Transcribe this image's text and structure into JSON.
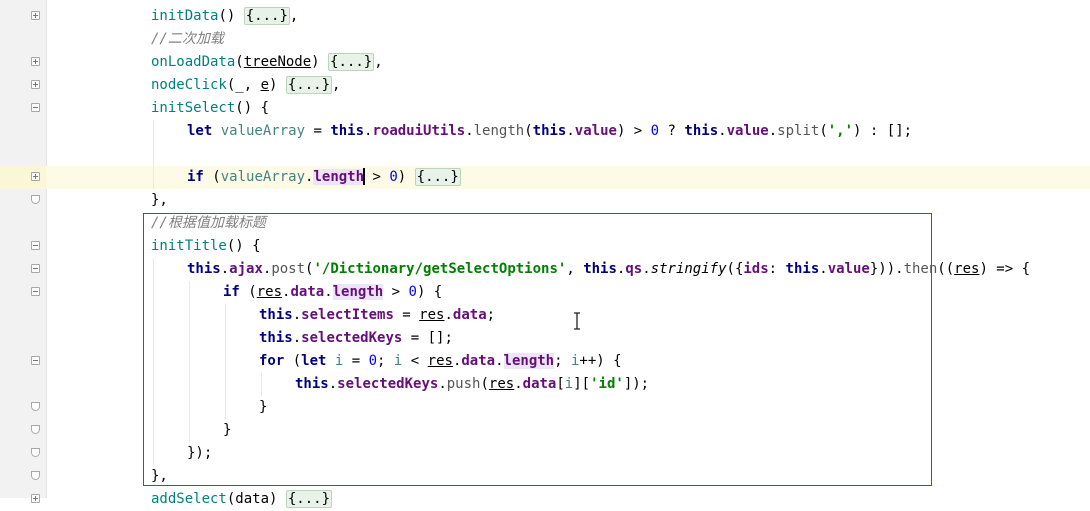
{
  "editor": {
    "lines": [
      {
        "id": "l1",
        "fold": "plus",
        "indent": 0,
        "tokens": [
          {
            "t": "initData",
            "c": "fn"
          },
          {
            "t": "() ",
            "c": ""
          },
          {
            "t": "{...}",
            "c": "folded"
          },
          {
            "t": ",",
            "c": ""
          }
        ]
      },
      {
        "id": "l2",
        "fold": "",
        "indent": 0,
        "tokens": [
          {
            "t": "//二次加载",
            "c": "cm"
          }
        ]
      },
      {
        "id": "l3",
        "fold": "plus",
        "indent": 0,
        "tokens": [
          {
            "t": "onLoadData",
            "c": "fn"
          },
          {
            "t": "(",
            "c": ""
          },
          {
            "t": "treeNode",
            "c": "ul"
          },
          {
            "t": ") ",
            "c": ""
          },
          {
            "t": "{...}",
            "c": "folded"
          },
          {
            "t": ",",
            "c": ""
          }
        ]
      },
      {
        "id": "l4",
        "fold": "plus",
        "indent": 0,
        "tokens": [
          {
            "t": "nodeClick",
            "c": "fn"
          },
          {
            "t": "(_, ",
            "c": ""
          },
          {
            "t": "e",
            "c": "ul"
          },
          {
            "t": ") ",
            "c": ""
          },
          {
            "t": "{...}",
            "c": "folded"
          },
          {
            "t": ",",
            "c": ""
          }
        ]
      },
      {
        "id": "l5",
        "fold": "minus",
        "indent": 0,
        "tokens": [
          {
            "t": "initSelect",
            "c": "fn"
          },
          {
            "t": "() {",
            "c": ""
          }
        ]
      },
      {
        "id": "l6",
        "fold": "",
        "indent": 1,
        "tokens": [
          {
            "t": "let ",
            "c": "kw"
          },
          {
            "t": "valueArray",
            "c": "var"
          },
          {
            "t": " = ",
            "c": ""
          },
          {
            "t": "this",
            "c": "kw"
          },
          {
            "t": ".",
            "c": ""
          },
          {
            "t": "roaduiUtils",
            "c": "prop"
          },
          {
            "t": ".",
            "c": ""
          },
          {
            "t": "length",
            "c": "call"
          },
          {
            "t": "(",
            "c": ""
          },
          {
            "t": "this",
            "c": "kw"
          },
          {
            "t": ".",
            "c": ""
          },
          {
            "t": "value",
            "c": "prop"
          },
          {
            "t": ") > ",
            "c": ""
          },
          {
            "t": "0",
            "c": "num"
          },
          {
            "t": " ? ",
            "c": ""
          },
          {
            "t": "this",
            "c": "kw"
          },
          {
            "t": ".",
            "c": ""
          },
          {
            "t": "value",
            "c": "prop"
          },
          {
            "t": ".",
            "c": ""
          },
          {
            "t": "split",
            "c": "call"
          },
          {
            "t": "(",
            "c": ""
          },
          {
            "t": "','",
            "c": "str"
          },
          {
            "t": ") : [];",
            "c": ""
          }
        ]
      },
      {
        "id": "l7",
        "fold": "",
        "indent": 1,
        "tokens": []
      },
      {
        "id": "l8",
        "fold": "plus",
        "indent": 1,
        "current": true,
        "tokens": [
          {
            "t": "if ",
            "c": "kw"
          },
          {
            "t": "(",
            "c": ""
          },
          {
            "t": "valueArray",
            "c": "var"
          },
          {
            "t": ".",
            "c": ""
          },
          {
            "t": "length",
            "c": "prop hl"
          },
          {
            "t": "|",
            "c": "caret"
          },
          {
            "t": " > ",
            "c": ""
          },
          {
            "t": "0",
            "c": "num"
          },
          {
            "t": ") ",
            "c": ""
          },
          {
            "t": "{...}",
            "c": "folded"
          }
        ]
      },
      {
        "id": "l9",
        "fold": "end",
        "indent": 0,
        "tokens": [
          {
            "t": "},",
            "c": ""
          }
        ]
      },
      {
        "id": "l10",
        "fold": "",
        "indent": 0,
        "tokens": [
          {
            "t": "//根据值加载标题",
            "c": "cm"
          }
        ]
      },
      {
        "id": "l11",
        "fold": "minus",
        "indent": 0,
        "tokens": [
          {
            "t": "initTitle",
            "c": "fn"
          },
          {
            "t": "() {",
            "c": ""
          }
        ]
      },
      {
        "id": "l12",
        "fold": "minus",
        "indent": 1,
        "tokens": [
          {
            "t": "this",
            "c": "kw"
          },
          {
            "t": ".",
            "c": ""
          },
          {
            "t": "ajax",
            "c": "prop"
          },
          {
            "t": ".",
            "c": ""
          },
          {
            "t": "post",
            "c": "call"
          },
          {
            "t": "(",
            "c": ""
          },
          {
            "t": "'/Dictionary/getSelectOptions'",
            "c": "str"
          },
          {
            "t": ", ",
            "c": ""
          },
          {
            "t": "this",
            "c": "kw"
          },
          {
            "t": ".",
            "c": ""
          },
          {
            "t": "qs",
            "c": "prop"
          },
          {
            "t": ".",
            "c": ""
          },
          {
            "t": "stringify",
            "c": "it"
          },
          {
            "t": "({",
            "c": ""
          },
          {
            "t": "ids",
            "c": "prop"
          },
          {
            "t": ": ",
            "c": ""
          },
          {
            "t": "this",
            "c": "kw"
          },
          {
            "t": ".",
            "c": ""
          },
          {
            "t": "value",
            "c": "prop"
          },
          {
            "t": "})).",
            "c": ""
          },
          {
            "t": "then",
            "c": "call"
          },
          {
            "t": "((",
            "c": ""
          },
          {
            "t": "res",
            "c": "ul"
          },
          {
            "t": ") => {",
            "c": ""
          }
        ]
      },
      {
        "id": "l13",
        "fold": "minus",
        "indent": 2,
        "tokens": [
          {
            "t": "if ",
            "c": "kw"
          },
          {
            "t": "(",
            "c": ""
          },
          {
            "t": "res",
            "c": "ul"
          },
          {
            "t": ".",
            "c": ""
          },
          {
            "t": "data",
            "c": "prop"
          },
          {
            "t": ".",
            "c": ""
          },
          {
            "t": "length",
            "c": "prop hl"
          },
          {
            "t": " > ",
            "c": ""
          },
          {
            "t": "0",
            "c": "num"
          },
          {
            "t": ") {",
            "c": ""
          }
        ]
      },
      {
        "id": "l14",
        "fold": "",
        "indent": 3,
        "tokens": [
          {
            "t": "this",
            "c": "kw"
          },
          {
            "t": ".",
            "c": ""
          },
          {
            "t": "selectItems",
            "c": "prop"
          },
          {
            "t": " = ",
            "c": ""
          },
          {
            "t": "res",
            "c": "ul"
          },
          {
            "t": ".",
            "c": ""
          },
          {
            "t": "data",
            "c": "prop"
          },
          {
            "t": ";",
            "c": ""
          }
        ]
      },
      {
        "id": "l15",
        "fold": "",
        "indent": 3,
        "tokens": [
          {
            "t": "this",
            "c": "kw"
          },
          {
            "t": ".",
            "c": ""
          },
          {
            "t": "selectedKeys",
            "c": "prop"
          },
          {
            "t": " = [];",
            "c": ""
          }
        ]
      },
      {
        "id": "l16",
        "fold": "minus",
        "indent": 3,
        "tokens": [
          {
            "t": "for ",
            "c": "kw"
          },
          {
            "t": "(",
            "c": ""
          },
          {
            "t": "let ",
            "c": "kw"
          },
          {
            "t": "i",
            "c": "var"
          },
          {
            "t": " = ",
            "c": ""
          },
          {
            "t": "0",
            "c": "num"
          },
          {
            "t": "; ",
            "c": ""
          },
          {
            "t": "i",
            "c": "var"
          },
          {
            "t": " < ",
            "c": ""
          },
          {
            "t": "res",
            "c": "ul"
          },
          {
            "t": ".",
            "c": ""
          },
          {
            "t": "data",
            "c": "prop"
          },
          {
            "t": ".",
            "c": ""
          },
          {
            "t": "length",
            "c": "prop hl"
          },
          {
            "t": "; ",
            "c": ""
          },
          {
            "t": "i",
            "c": "var"
          },
          {
            "t": "++) {",
            "c": ""
          }
        ]
      },
      {
        "id": "l17",
        "fold": "",
        "indent": 4,
        "tokens": [
          {
            "t": "this",
            "c": "kw"
          },
          {
            "t": ".",
            "c": ""
          },
          {
            "t": "selectedKeys",
            "c": "prop"
          },
          {
            "t": ".",
            "c": ""
          },
          {
            "t": "push",
            "c": "call"
          },
          {
            "t": "(",
            "c": ""
          },
          {
            "t": "res",
            "c": "ul"
          },
          {
            "t": ".",
            "c": ""
          },
          {
            "t": "data",
            "c": "prop"
          },
          {
            "t": "[",
            "c": ""
          },
          {
            "t": "i",
            "c": "var"
          },
          {
            "t": "][",
            "c": ""
          },
          {
            "t": "'id'",
            "c": "str"
          },
          {
            "t": "]);",
            "c": ""
          }
        ]
      },
      {
        "id": "l18",
        "fold": "end",
        "indent": 3,
        "tokens": [
          {
            "t": "}",
            "c": ""
          }
        ]
      },
      {
        "id": "l19",
        "fold": "end",
        "indent": 2,
        "tokens": [
          {
            "t": "}",
            "c": ""
          }
        ]
      },
      {
        "id": "l20",
        "fold": "end",
        "indent": 1,
        "tokens": [
          {
            "t": "});",
            "c": ""
          }
        ]
      },
      {
        "id": "l21",
        "fold": "end",
        "indent": 0,
        "tokens": [
          {
            "t": "},",
            "c": ""
          }
        ]
      },
      {
        "id": "l22",
        "fold": "plus",
        "indent": 0,
        "tokens": [
          {
            "t": "addSelect",
            "c": "fn"
          },
          {
            "t": "(data) ",
            "c": ""
          },
          {
            "t": "{...}",
            "c": "folded"
          }
        ]
      }
    ]
  },
  "colors": {
    "keyword": "#000080",
    "function": "#008080",
    "property": "#660e7a",
    "string": "#008000",
    "number": "#0000ff",
    "comment": "#808080",
    "current_line": "#fdfbe5",
    "annotation_box": "#d32020"
  },
  "annotation": {
    "shape": "red-rectangle",
    "covers": "initTitle"
  },
  "cursor": {
    "type": "text-i-beam"
  }
}
